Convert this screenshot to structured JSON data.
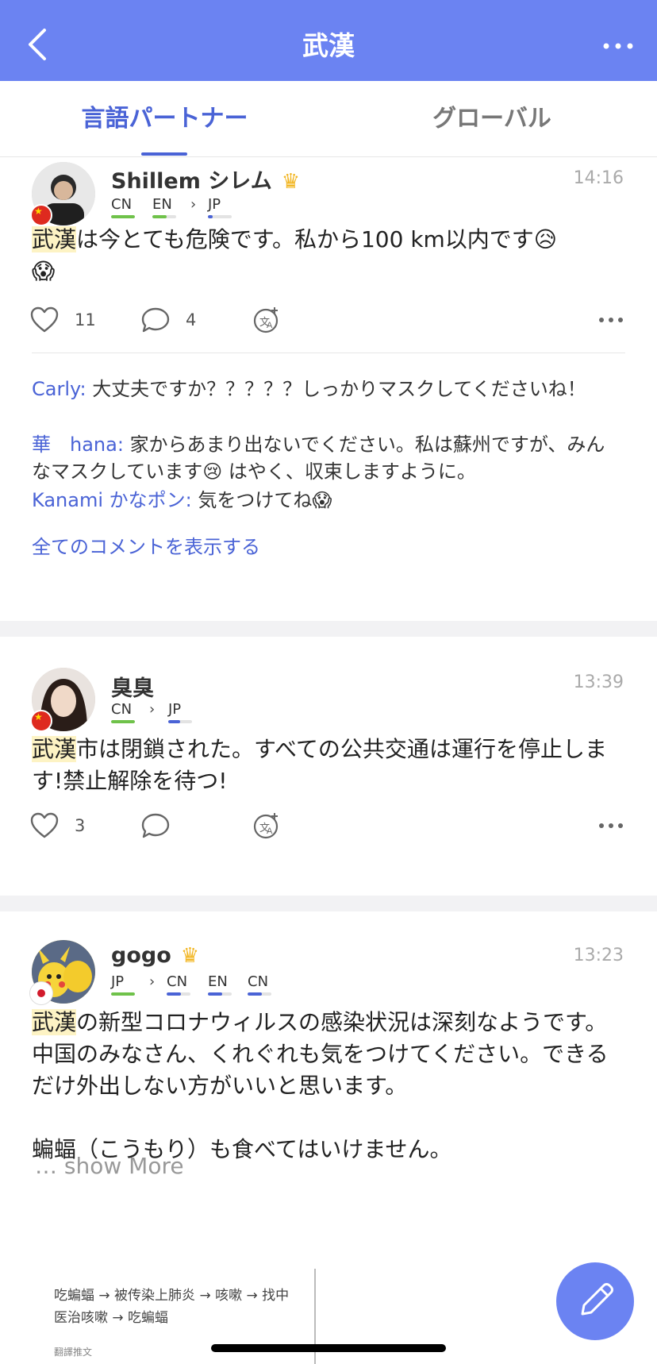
{
  "header": {
    "title": "武漢",
    "back_icon": "chevron-left-icon",
    "more_icon": "more-dots-icon",
    "background": "#6b83f2"
  },
  "tabs": [
    {
      "label": "言語パートナー",
      "active": true
    },
    {
      "label": "グローバル",
      "active": false
    }
  ],
  "posts": [
    {
      "username": "Shillem シレム",
      "premium": true,
      "time": "14:16",
      "flag": "cn",
      "native": [
        {
          "code": "CN",
          "level": 1.0
        },
        {
          "code": "EN",
          "level": 0.6
        }
      ],
      "learning": [
        {
          "code": "JP",
          "level": 0.2
        }
      ],
      "content_highlight": "武漢",
      "content_rest": "は今とても危険です。私から100 km以内です😥\n😱",
      "likes": "11",
      "comments_count": "4",
      "comments": [
        {
          "name": "Carly:",
          "text": "大丈夫ですか？？？？？しっかりマスクしてくださいね！"
        },
        {
          "name": "華　hana:",
          "text": "家からあまり出ないでください。私は蘇州ですが、みんなマスクしています😢 はやく、収束しますように。"
        },
        {
          "name": "Kanami かなポン:",
          "text": "気をつけてね😱"
        }
      ],
      "all_comments_label": "全てのコメントを表示する"
    },
    {
      "username": "臭臭",
      "premium": false,
      "time": "13:39",
      "flag": "cn",
      "native": [
        {
          "code": "CN",
          "level": 1.0
        }
      ],
      "learning": [
        {
          "code": "JP",
          "level": 0.5
        }
      ],
      "content_highlight": "武漢",
      "content_rest": "市は閉鎖された。すべての公共交通は運行を停止します!禁止解除を待つ!",
      "likes": "3",
      "comments_count": ""
    },
    {
      "username": "gogo",
      "premium": true,
      "time": "13:23",
      "flag": "jp",
      "native": [
        {
          "code": "JP",
          "level": 1.0
        }
      ],
      "learning": [
        {
          "code": "CN",
          "level": 0.6
        },
        {
          "code": "EN",
          "level": 0.6
        },
        {
          "code": "CN",
          "level": 0.6
        }
      ],
      "content_highlight": "武漢",
      "content_rest": "の新型コロナウィルスの感染状況は深刻なようです。\n中国のみなさん、くれぐれも気をつけてください。できるだけ外出しない方がいいと思います。\n\n蝙蝠（こうもり）も食べてはいけません。",
      "show_more": "… show More",
      "image_text": "吃蝙蝠 → 被传染上肺炎 → 咳嗽 → 找中医治咳嗽 → 吃蝙蝠",
      "image_caption": "翻譯推文"
    }
  ],
  "fab_icon": "pencil-icon",
  "colors": {
    "accent": "#4a63d6",
    "highlight": "#fdf3c4",
    "native_bar": "#6fc24a",
    "learning_bar": "#4a63d6"
  }
}
